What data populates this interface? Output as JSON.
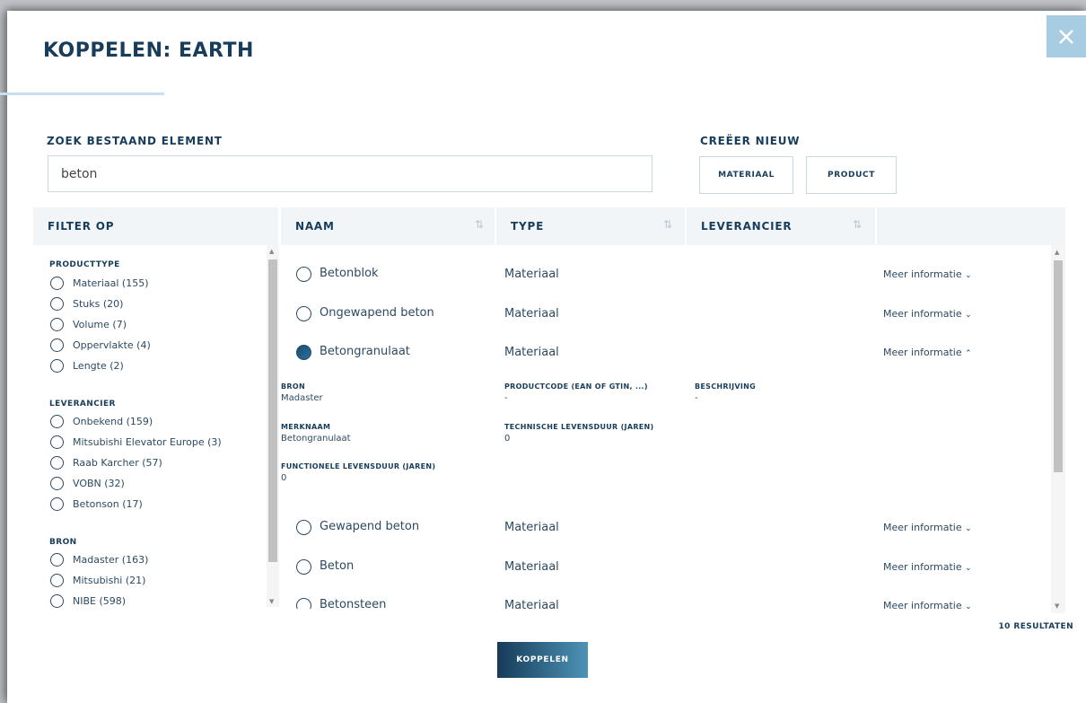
{
  "title": "KOPPELEN: EARTH",
  "search": {
    "label": "ZOEK BESTAAND ELEMENT",
    "value": "beton"
  },
  "create": {
    "label": "CREËER NIEUW",
    "materiaal": "MATERIAAL",
    "product": "PRODUCT"
  },
  "filters": {
    "header": "FILTER OP",
    "groups": [
      {
        "title": "PRODUCTTYPE",
        "options": [
          "Materiaal (155)",
          "Stuks (20)",
          "Volume (7)",
          "Oppervlakte (4)",
          "Lengte (2)"
        ]
      },
      {
        "title": "LEVERANCIER",
        "options": [
          "Onbekend (159)",
          "Mitsubishi Elevator Europe (3)",
          "Raab Karcher (57)",
          "VOBN (32)",
          "Betonson (17)"
        ]
      },
      {
        "title": "BRON",
        "options": [
          "Madaster (163)",
          "Mitsubishi (21)",
          "NIBE (598)"
        ]
      }
    ]
  },
  "table": {
    "columns": [
      "NAAM",
      "TYPE",
      "LEVERANCIER"
    ],
    "sort_icon": "⇅",
    "rows": [
      {
        "name": "Betonblok",
        "type": "Materiaal",
        "more": "Meer informatie",
        "expanded": false
      },
      {
        "name": "Ongewapend beton",
        "type": "Materiaal",
        "more": "Meer informatie",
        "expanded": false
      },
      {
        "name": "Betongranulaat",
        "type": "Materiaal",
        "more": "Meer informatie",
        "expanded": true
      },
      {
        "name": "Gewapend beton",
        "type": "Materiaal",
        "more": "Meer informatie",
        "expanded": false
      },
      {
        "name": "Beton",
        "type": "Materiaal",
        "more": "Meer informatie",
        "expanded": false
      },
      {
        "name": "Betonsteen",
        "type": "Materiaal",
        "more": "Meer informatie",
        "expanded": false
      }
    ],
    "detail": {
      "bron_label": "BRON",
      "bron": "Madaster",
      "productcode_label": "PRODUCTCODE (EAN OF GTIN, ...)",
      "productcode": "-",
      "beschrijving_label": "BESCHRIJVING",
      "beschrijving": "-",
      "merknaam_label": "MERKNAAM",
      "merknaam": "Betongranulaat",
      "technisch_label": "TECHNISCHE LEVENSDUUR (JAREN)",
      "technisch": "0",
      "functioneel_label": "FUNCTIONELE LEVENSDUUR (JAREN)",
      "functioneel": "0"
    }
  },
  "results": "10 RESULTATEN",
  "submit": "KOPPELEN",
  "icons": {
    "close": "close-icon",
    "chevron_down": "chevron-down-icon",
    "chevron_up": "chevron-up-icon"
  }
}
